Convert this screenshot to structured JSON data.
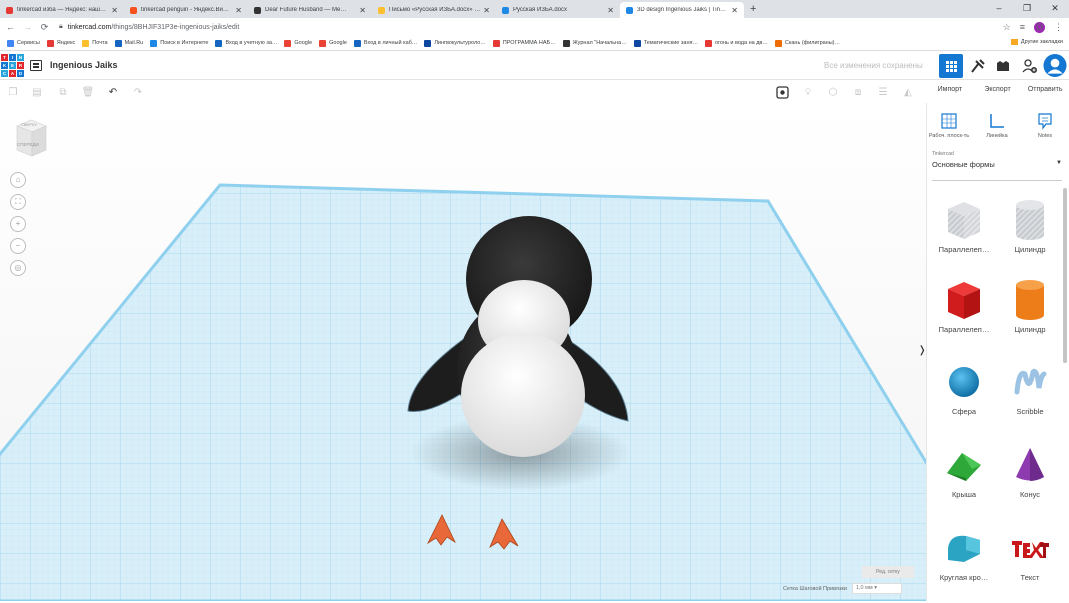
{
  "browser": {
    "tabs": [
      {
        "title": "tinkercad изба — Яндекс: нашл…",
        "color": "#e53935",
        "active": false
      },
      {
        "title": "tinkercad penguin - Яндекс.Вид…",
        "color": "#f4511e",
        "active": false
      },
      {
        "title": "Dear Future Husband — Me…",
        "color": "#333333",
        "active": false
      },
      {
        "title": "Письмо «Русская ИЗБА.docx» …",
        "color": "#fbc02d",
        "active": false
      },
      {
        "title": "Русская ИЗБА.docx",
        "color": "#1e88e5",
        "active": false
      },
      {
        "title": "3D design Ingenious Jaiks | Tink…",
        "color": "#1e88e5",
        "active": true
      }
    ],
    "new_tab": "+",
    "window_controls": [
      "–",
      "❐",
      "✕"
    ],
    "url_host": "tinkercad.com",
    "url_path": "/things/8BHJIF31P3e-ingenious-jaiks/edit",
    "profile_letter": "O",
    "bookmarks": [
      {
        "label": "Сервисы",
        "color": "#4285f4"
      },
      {
        "label": "Яндекс",
        "color": "#e53935"
      },
      {
        "label": "Почта",
        "color": "#fbc02d"
      },
      {
        "label": "Mail.Ru",
        "color": "#1565c0"
      },
      {
        "label": "Поиск в Интернете",
        "color": "#1e88e5"
      },
      {
        "label": "Вход в учетную за…",
        "color": "#1565c0"
      },
      {
        "label": "Google",
        "color": "#ea4335"
      },
      {
        "label": "Google",
        "color": "#ea4335"
      },
      {
        "label": "Вход в личный каб…",
        "color": "#1565c0"
      },
      {
        "label": "Лингвокультуроло…",
        "color": "#0d47a1"
      },
      {
        "label": "ПРОГРАММА НАБ…",
        "color": "#e53935"
      },
      {
        "label": "Журнал \"Начальна…",
        "color": "#333333"
      },
      {
        "label": "Тематические заня…",
        "color": "#0d47a1"
      },
      {
        "label": "огонь и вода на дв…",
        "color": "#e53935"
      },
      {
        "label": "Скань (филиграны)…",
        "color": "#ef6c00"
      }
    ],
    "other_bookmarks": "Другие закладки"
  },
  "app": {
    "logo_letters": [
      "TIN",
      "KER",
      "CAD"
    ],
    "design_name": "Ingenious Jaiks",
    "save_status": "Все изменения сохранены",
    "actions": [
      "Импорт",
      "Экспорт",
      "Отправить"
    ]
  },
  "workplane": {
    "viewcube_top": "СВЕРХУ",
    "viewcube_front": "СПЕРЕДИ",
    "edit_grid": "Ред. сетку",
    "snap_label": "Сетка Шаговой Привязки",
    "snap_value": "1,0 мм",
    "colors": {
      "grid_fill": "#d6eef8",
      "grid_line": "#a9d8ee",
      "edge": "#9fd8f0",
      "body": "#2b2b2b",
      "belly": "#f2f2f2",
      "feet": "#e8683a"
    }
  },
  "panel": {
    "tools": [
      {
        "label": "Рабоч. плоск-ть",
        "icon": "workplane-icon"
      },
      {
        "label": "Линейка",
        "icon": "ruler-icon"
      },
      {
        "label": "Notes",
        "icon": "notes-icon"
      }
    ],
    "library_small": "Tinkercad",
    "library_name": "Основные формы",
    "shapes": [
      {
        "label": "Параллелеп…",
        "icon": "box-hole-icon"
      },
      {
        "label": "Цилиндр",
        "icon": "cylinder-hole-icon"
      },
      {
        "label": "Параллелеп…",
        "icon": "box-icon"
      },
      {
        "label": "Цилиндр",
        "icon": "cylinder-icon"
      },
      {
        "label": "Сфера",
        "icon": "sphere-icon"
      },
      {
        "label": "Scribble",
        "icon": "scribble-icon"
      },
      {
        "label": "Крыша",
        "icon": "roof-icon"
      },
      {
        "label": "Конус",
        "icon": "cone-icon"
      },
      {
        "label": "Круглая кро…",
        "icon": "round-roof-icon"
      },
      {
        "label": "Текст",
        "icon": "text-icon"
      }
    ]
  }
}
